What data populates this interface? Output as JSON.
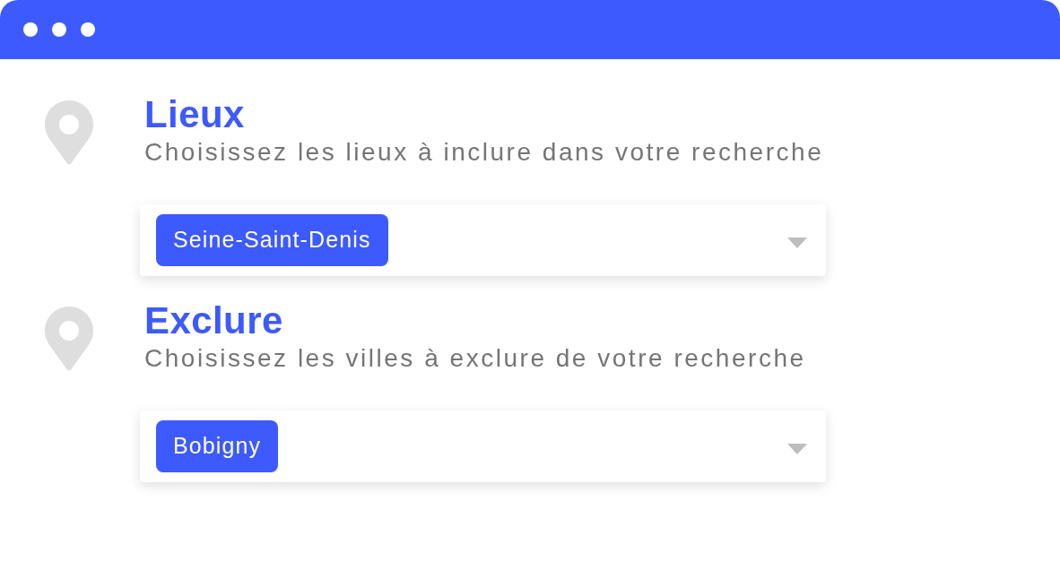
{
  "sections": [
    {
      "title": "Lieux",
      "subtitle": "Choisissez les lieux à inclure dans votre recherche",
      "select": {
        "tags": [
          "Seine-Saint-Denis"
        ]
      }
    },
    {
      "title": "Exclure",
      "subtitle": "Choisissez les villes à exclure de votre recherche",
      "select": {
        "tags": [
          "Bobigny"
        ]
      }
    }
  ]
}
